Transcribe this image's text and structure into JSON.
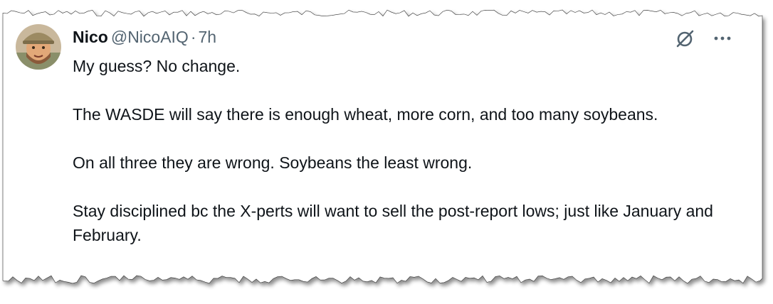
{
  "tweet": {
    "author": {
      "display_name": "Nico",
      "handle": "@NicoAIQ",
      "separator": "·",
      "timestamp": "7h",
      "avatar_icon": "avatar"
    },
    "actions": {
      "grok_icon": "grok-icon",
      "more_icon": "more-options-icon"
    },
    "paragraphs": [
      "My guess? No change.",
      "The WASDE will say there is enough wheat, more corn, and too many soybeans.",
      "On all three they are wrong. Soybeans the least wrong.",
      "Stay disciplined bc the X-perts will want to sell the post-report lows; just like January and February."
    ]
  },
  "colors": {
    "text_primary": "#0f1419",
    "text_secondary": "#536471",
    "background": "#ffffff"
  }
}
